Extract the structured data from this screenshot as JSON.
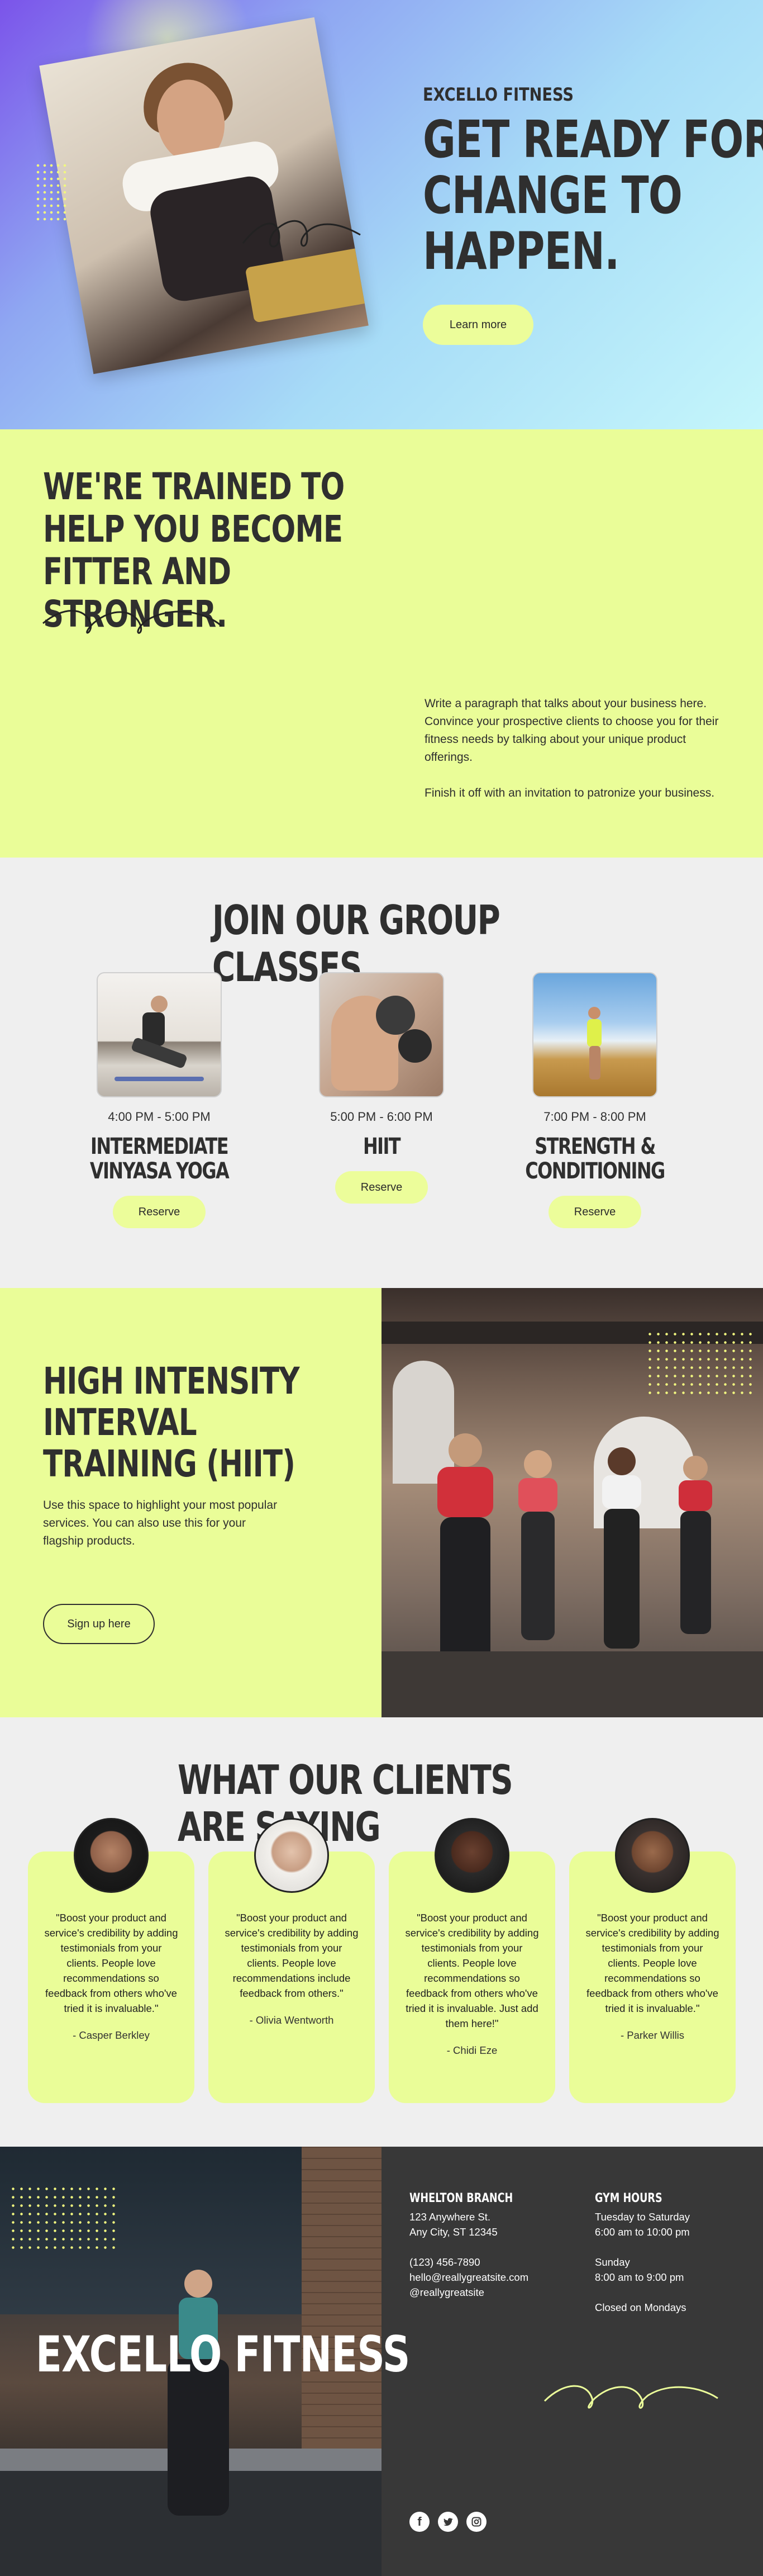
{
  "hero": {
    "brand": "EXCELLO FITNESS",
    "title": "GET READY FOR CHANGE TO HAPPEN.",
    "button": "Learn more"
  },
  "trained": {
    "title": "WE'RE TRAINED TO HELP YOU BECOME FITTER AND STRONGER.",
    "paragraph1": "Write a paragraph that talks about your business here. Convince your prospective clients to choose you for their fitness needs by talking about your unique product offerings.",
    "paragraph2": "Finish it off with an invitation to patronize your business."
  },
  "classes": {
    "title": "JOIN OUR GROUP CLASSES",
    "items": [
      {
        "time": "4:00 PM - 5:00 PM",
        "name": "INTERMEDIATE VINYASA YOGA",
        "button": "Reserve"
      },
      {
        "time": "5:00 PM - 6:00 PM",
        "name": "HIIT",
        "button": "Reserve"
      },
      {
        "time": "7:00 PM - 8:00 PM",
        "name": "STRENGTH & CONDITIONING",
        "button": "Reserve"
      }
    ]
  },
  "hiit": {
    "title": "HIGH INTENSITY INTERVAL TRAINING (HIIT)",
    "text": "Use this space to highlight your most popular services. You can also use this for your flagship products.",
    "button": "Sign up here"
  },
  "testimonials": {
    "title": "WHAT OUR CLIENTS ARE SAYING",
    "items": [
      {
        "quote": "\"Boost your product and service's credibility by adding testimonials from your clients. People love recommendations so feedback from others who've tried it is invaluable.\"",
        "author": "- Casper Berkley"
      },
      {
        "quote": "\"Boost your product and service's credibility by adding testimonials from your clients. People love recommendations include feedback from others.\"",
        "author": "- Olivia Wentworth"
      },
      {
        "quote": "\"Boost your product and service's credibility by adding testimonials from your clients. People love recommendations so feedback from others who've tried it is invaluable. Just add them here!\"",
        "author": "- Chidi Eze"
      },
      {
        "quote": "\"Boost your product and service's credibility by adding testimonials from your clients. People love recommendations so feedback from others who've tried it is invaluable.\"",
        "author": "- Parker Willis"
      }
    ]
  },
  "footer": {
    "brand": "EXCELLO FITNESS",
    "branch_heading": "WHELTON BRANCH",
    "address1": "123 Anywhere St.",
    "address2": "Any City, ST 12345",
    "phone": "(123) 456-7890",
    "email": "hello@reallygreatsite.com",
    "handle": "@reallygreatsite",
    "hours_heading": "GYM HOURS",
    "weekday_label": "Tuesday to Saturday",
    "weekday_hours": "6:00 am to 10:00 pm",
    "sunday_label": "Sunday",
    "sunday_hours": "8:00 am to 9:00 pm",
    "closed": "Closed on Mondays",
    "social": [
      "facebook-icon",
      "twitter-icon",
      "instagram-icon"
    ]
  },
  "colors": {
    "accent": "#eafd98",
    "button": "#ecfd9a",
    "dark": "#383838",
    "text": "#2f2f2f"
  }
}
